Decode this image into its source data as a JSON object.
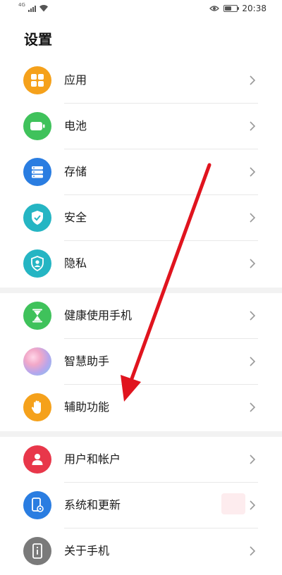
{
  "status_bar": {
    "network": "4G",
    "time": "20:38",
    "battery_level": 0.55,
    "icons": [
      "signal-icon",
      "wifi-icon",
      "eye-icon",
      "battery-icon"
    ]
  },
  "page": {
    "title": "设置"
  },
  "groups": [
    {
      "items": [
        {
          "label": "应用",
          "icon": "apps-grid-icon",
          "color": "#f5a11b"
        },
        {
          "label": "电池",
          "icon": "battery-icon",
          "color": "#3fc25b"
        },
        {
          "label": "存储",
          "icon": "storage-icon",
          "color": "#2a7de1"
        },
        {
          "label": "安全",
          "icon": "shield-check-icon",
          "color": "#25b5c3"
        },
        {
          "label": "隐私",
          "icon": "privacy-shield-icon",
          "color": "#25b5c3"
        }
      ]
    },
    {
      "items": [
        {
          "label": "健康使用手机",
          "icon": "hourglass-icon",
          "color": "#3fc25b"
        },
        {
          "label": "智慧助手",
          "icon": "smart-assistant-icon",
          "color": "#c8a0e8"
        },
        {
          "label": "辅助功能",
          "icon": "hand-icon",
          "color": "#f5a11b"
        }
      ]
    },
    {
      "items": [
        {
          "label": "用户和帐户",
          "icon": "user-icon",
          "color": "#e8374a"
        },
        {
          "label": "系统和更新",
          "icon": "system-update-icon",
          "color": "#2a7de1"
        },
        {
          "label": "关于手机",
          "icon": "phone-info-icon",
          "color": "#7a7a7a"
        }
      ]
    }
  ],
  "annotation": {
    "arrow_color": "#e0141e"
  }
}
